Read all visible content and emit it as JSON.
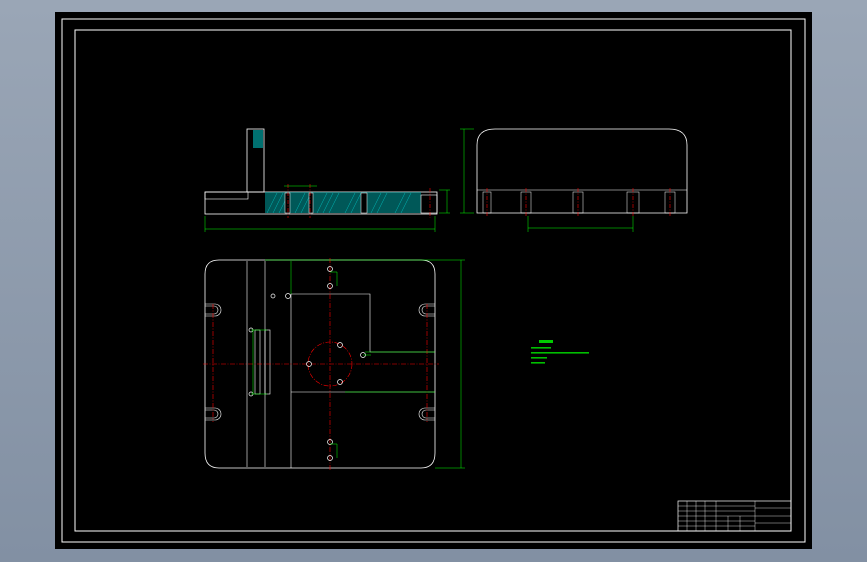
{
  "colors": {
    "background": "#000000",
    "frame": "#ffffff",
    "outline": "#ffffff",
    "dimension": "#00ff00",
    "centerline": "#ff0000",
    "hatch": "#00cccc",
    "window": "#8a97a9"
  },
  "views": {
    "front": "front-section-view",
    "side": "side-view",
    "top": "top-plan-view"
  },
  "notes": {
    "title": "",
    "lines": [
      "",
      "",
      "",
      ""
    ]
  },
  "title_block": {
    "cells": [
      "",
      "",
      "",
      "",
      "",
      ""
    ]
  }
}
